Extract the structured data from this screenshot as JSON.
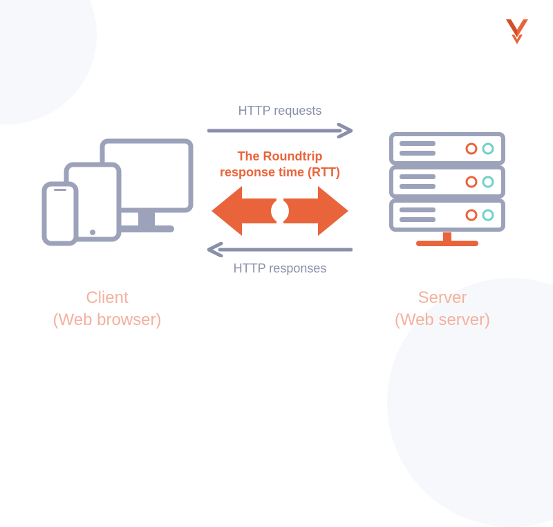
{
  "logo": {
    "name": "wp-rocket-logo"
  },
  "diagram": {
    "http_requests_label": "HTTP requests",
    "http_responses_label": "HTTP responses",
    "rtt_line1": "The Roundtrip",
    "rtt_line2": "response time (RTT)",
    "client_title": "Client",
    "client_subtitle": "(Web browser)",
    "server_title": "Server",
    "server_subtitle": "(Web server)"
  },
  "colors": {
    "gray": "#8a8faa",
    "orange": "#e9643a",
    "peach": "#f3b19e"
  }
}
